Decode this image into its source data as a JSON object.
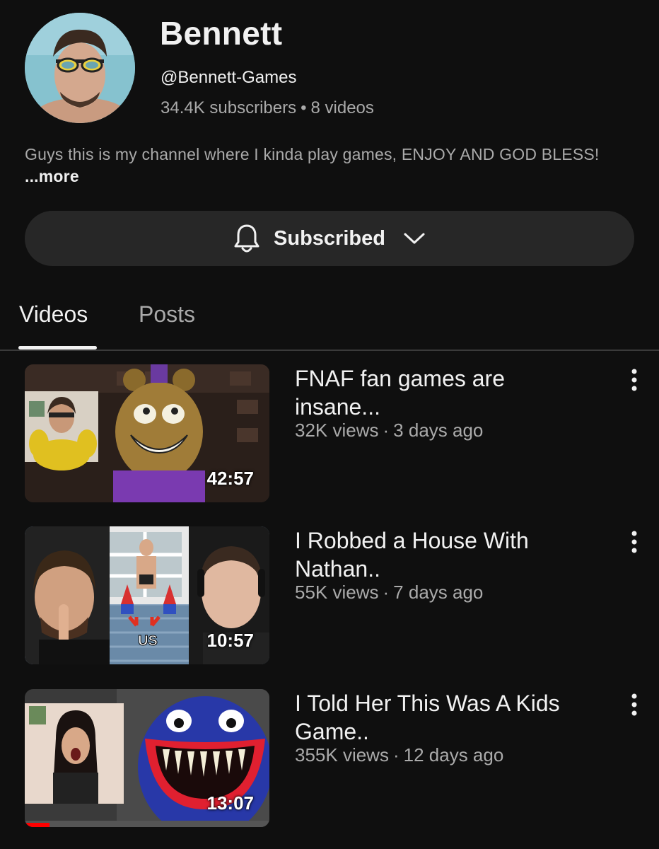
{
  "channel": {
    "name": "Bennett",
    "handle": "@Bennett-Games",
    "subscribers": "34.4K subscribers",
    "meta_dot": "•",
    "video_count": "8 videos",
    "description": "Guys this is my channel where I kinda play games, ENJOY AND GOD BLESS! ",
    "more_label": "...more"
  },
  "subscribe": {
    "label": "Subscribed",
    "icon": "bell-icon",
    "dropdown_icon": "chevron-down-icon"
  },
  "tabs": [
    {
      "label": "Videos",
      "active": true
    },
    {
      "label": "Posts",
      "active": false
    }
  ],
  "videos": [
    {
      "title": "FNAF fan games are insane...",
      "views": "32K views",
      "sep": "·",
      "age": "3 days ago",
      "duration": "42:57",
      "progress": 0
    },
    {
      "title": "I Robbed a House With Nathan..",
      "views": "55K views",
      "sep": "·",
      "age": "7 days ago",
      "duration": "10:57",
      "progress": 0,
      "thumb_label": "US"
    },
    {
      "title": "I Told Her This Was A Kids Game..",
      "views": "355K views",
      "sep": "·",
      "age": "12 days ago",
      "duration": "13:07",
      "progress": 0.1
    }
  ],
  "colors": {
    "background": "#0f0f0f",
    "button_bg": "#272727",
    "secondary_text": "#aaaaaa",
    "progress_red": "#ff0000"
  }
}
